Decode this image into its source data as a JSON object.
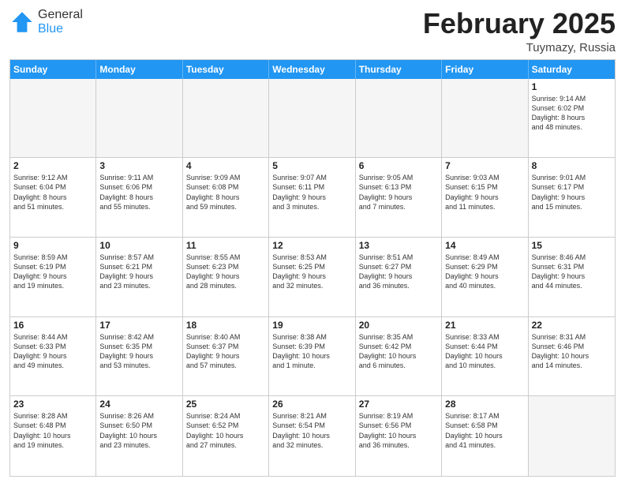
{
  "logo": {
    "general": "General",
    "blue": "Blue"
  },
  "header": {
    "month_year": "February 2025",
    "location": "Tuymazy, Russia"
  },
  "weekdays": [
    "Sunday",
    "Monday",
    "Tuesday",
    "Wednesday",
    "Thursday",
    "Friday",
    "Saturday"
  ],
  "weeks": [
    [
      {
        "day": "",
        "empty": true
      },
      {
        "day": "",
        "empty": true
      },
      {
        "day": "",
        "empty": true
      },
      {
        "day": "",
        "empty": true
      },
      {
        "day": "",
        "empty": true
      },
      {
        "day": "",
        "empty": true
      },
      {
        "day": "1",
        "info": "Sunrise: 9:14 AM\nSunset: 6:02 PM\nDaylight: 8 hours\nand 48 minutes."
      }
    ],
    [
      {
        "day": "2",
        "info": "Sunrise: 9:12 AM\nSunset: 6:04 PM\nDaylight: 8 hours\nand 51 minutes."
      },
      {
        "day": "3",
        "info": "Sunrise: 9:11 AM\nSunset: 6:06 PM\nDaylight: 8 hours\nand 55 minutes."
      },
      {
        "day": "4",
        "info": "Sunrise: 9:09 AM\nSunset: 6:08 PM\nDaylight: 8 hours\nand 59 minutes."
      },
      {
        "day": "5",
        "info": "Sunrise: 9:07 AM\nSunset: 6:11 PM\nDaylight: 9 hours\nand 3 minutes."
      },
      {
        "day": "6",
        "info": "Sunrise: 9:05 AM\nSunset: 6:13 PM\nDaylight: 9 hours\nand 7 minutes."
      },
      {
        "day": "7",
        "info": "Sunrise: 9:03 AM\nSunset: 6:15 PM\nDaylight: 9 hours\nand 11 minutes."
      },
      {
        "day": "8",
        "info": "Sunrise: 9:01 AM\nSunset: 6:17 PM\nDaylight: 9 hours\nand 15 minutes."
      }
    ],
    [
      {
        "day": "9",
        "info": "Sunrise: 8:59 AM\nSunset: 6:19 PM\nDaylight: 9 hours\nand 19 minutes."
      },
      {
        "day": "10",
        "info": "Sunrise: 8:57 AM\nSunset: 6:21 PM\nDaylight: 9 hours\nand 23 minutes."
      },
      {
        "day": "11",
        "info": "Sunrise: 8:55 AM\nSunset: 6:23 PM\nDaylight: 9 hours\nand 28 minutes."
      },
      {
        "day": "12",
        "info": "Sunrise: 8:53 AM\nSunset: 6:25 PM\nDaylight: 9 hours\nand 32 minutes."
      },
      {
        "day": "13",
        "info": "Sunrise: 8:51 AM\nSunset: 6:27 PM\nDaylight: 9 hours\nand 36 minutes."
      },
      {
        "day": "14",
        "info": "Sunrise: 8:49 AM\nSunset: 6:29 PM\nDaylight: 9 hours\nand 40 minutes."
      },
      {
        "day": "15",
        "info": "Sunrise: 8:46 AM\nSunset: 6:31 PM\nDaylight: 9 hours\nand 44 minutes."
      }
    ],
    [
      {
        "day": "16",
        "info": "Sunrise: 8:44 AM\nSunset: 6:33 PM\nDaylight: 9 hours\nand 49 minutes."
      },
      {
        "day": "17",
        "info": "Sunrise: 8:42 AM\nSunset: 6:35 PM\nDaylight: 9 hours\nand 53 minutes."
      },
      {
        "day": "18",
        "info": "Sunrise: 8:40 AM\nSunset: 6:37 PM\nDaylight: 9 hours\nand 57 minutes."
      },
      {
        "day": "19",
        "info": "Sunrise: 8:38 AM\nSunset: 6:39 PM\nDaylight: 10 hours\nand 1 minute."
      },
      {
        "day": "20",
        "info": "Sunrise: 8:35 AM\nSunset: 6:42 PM\nDaylight: 10 hours\nand 6 minutes."
      },
      {
        "day": "21",
        "info": "Sunrise: 8:33 AM\nSunset: 6:44 PM\nDaylight: 10 hours\nand 10 minutes."
      },
      {
        "day": "22",
        "info": "Sunrise: 8:31 AM\nSunset: 6:46 PM\nDaylight: 10 hours\nand 14 minutes."
      }
    ],
    [
      {
        "day": "23",
        "info": "Sunrise: 8:28 AM\nSunset: 6:48 PM\nDaylight: 10 hours\nand 19 minutes."
      },
      {
        "day": "24",
        "info": "Sunrise: 8:26 AM\nSunset: 6:50 PM\nDaylight: 10 hours\nand 23 minutes."
      },
      {
        "day": "25",
        "info": "Sunrise: 8:24 AM\nSunset: 6:52 PM\nDaylight: 10 hours\nand 27 minutes."
      },
      {
        "day": "26",
        "info": "Sunrise: 8:21 AM\nSunset: 6:54 PM\nDaylight: 10 hours\nand 32 minutes."
      },
      {
        "day": "27",
        "info": "Sunrise: 8:19 AM\nSunset: 6:56 PM\nDaylight: 10 hours\nand 36 minutes."
      },
      {
        "day": "28",
        "info": "Sunrise: 8:17 AM\nSunset: 6:58 PM\nDaylight: 10 hours\nand 41 minutes."
      },
      {
        "day": "",
        "empty": true
      }
    ]
  ]
}
